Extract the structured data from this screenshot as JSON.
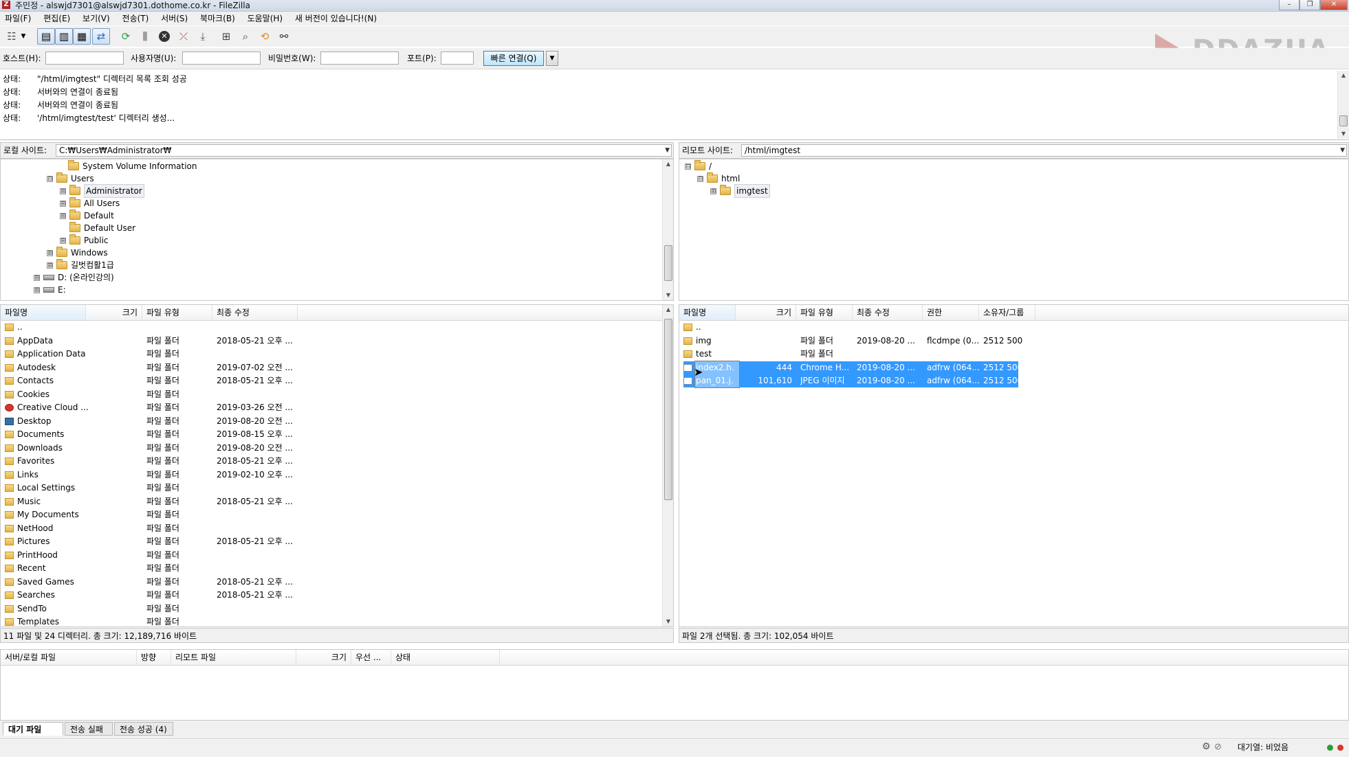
{
  "window": {
    "title": "주민정 - alswjd7301@alswjd7301.dothome.co.kr - FileZilla",
    "buttons": {
      "minimize": "–",
      "maximize": "❐",
      "close": "✕"
    }
  },
  "menu": [
    "파일(F)",
    "편집(E)",
    "보기(V)",
    "전송(T)",
    "서버(S)",
    "북마크(B)",
    "도움말(H)",
    "새 버전이 있습니다!(N)"
  ],
  "watermark": "DDAZUA",
  "quickconnect": {
    "host_label": "호스트(H):",
    "user_label": "사용자명(U):",
    "pass_label": "비밀번호(W):",
    "port_label": "포트(P):",
    "host_value": "",
    "user_value": "",
    "pass_value": "",
    "port_value": "",
    "connect_label": "빠른 연결(Q)",
    "dropdown_glyph": "▼"
  },
  "log": [
    {
      "key": "상태:",
      "msg": "\"/html/imgtest\" 디렉터리 목록 조회 성공"
    },
    {
      "key": "상태:",
      "msg": "서버와의 연결이 종료됨"
    },
    {
      "key": "상태:",
      "msg": "서버와의 연결이 종료됨"
    },
    {
      "key": "상태:",
      "msg": "'/html/imgtest/test' 디렉터리 생성..."
    }
  ],
  "local": {
    "site_label": "로컬 사이트:",
    "path": "C:₩Users₩Administrator₩",
    "tree": [
      {
        "label": "System Volume Information",
        "pm": ""
      },
      {
        "label": "Users",
        "pm": "⊟"
      },
      {
        "label": "Administrator",
        "pm": "⊞"
      },
      {
        "label": "All Users",
        "pm": "⊞"
      },
      {
        "label": "Default",
        "pm": "⊞"
      },
      {
        "label": "Default User",
        "pm": ""
      },
      {
        "label": "Public",
        "pm": "⊞"
      },
      {
        "label": "Windows",
        "pm": "⊞"
      },
      {
        "label": "길벗컴활1급",
        "pm": "⊞"
      },
      {
        "label": "D: (온라인강의)",
        "pm": "⊞"
      },
      {
        "label": "E:",
        "pm": "⊞"
      }
    ],
    "columns": [
      "파일명",
      "크기",
      "파일 유형",
      "최종 수정"
    ],
    "files": [
      {
        "name": "..",
        "size": "",
        "type": "",
        "modified": ""
      },
      {
        "name": "AppData",
        "size": "",
        "type": "파일 폴더",
        "modified": "2018-05-21 오후 ..."
      },
      {
        "name": "Application Data",
        "size": "",
        "type": "파일 폴더",
        "modified": ""
      },
      {
        "name": "Autodesk",
        "size": "",
        "type": "파일 폴더",
        "modified": "2019-07-02 오전 ..."
      },
      {
        "name": "Contacts",
        "size": "",
        "type": "파일 폴더",
        "modified": "2018-05-21 오후 ..."
      },
      {
        "name": "Cookies",
        "size": "",
        "type": "파일 폴더",
        "modified": ""
      },
      {
        "name": "Creative Cloud ...",
        "size": "",
        "type": "파일 폴더",
        "modified": "2019-03-26 오전 ..."
      },
      {
        "name": "Desktop",
        "size": "",
        "type": "파일 폴더",
        "modified": "2019-08-20 오전 ..."
      },
      {
        "name": "Documents",
        "size": "",
        "type": "파일 폴더",
        "modified": "2019-08-15 오후 ..."
      },
      {
        "name": "Downloads",
        "size": "",
        "type": "파일 폴더",
        "modified": "2019-08-20 오전 ..."
      },
      {
        "name": "Favorites",
        "size": "",
        "type": "파일 폴더",
        "modified": "2018-05-21 오후 ..."
      },
      {
        "name": "Links",
        "size": "",
        "type": "파일 폴더",
        "modified": "2019-02-10 오후 ..."
      },
      {
        "name": "Local Settings",
        "size": "",
        "type": "파일 폴더",
        "modified": ""
      },
      {
        "name": "Music",
        "size": "",
        "type": "파일 폴더",
        "modified": "2018-05-21 오후 ..."
      },
      {
        "name": "My Documents",
        "size": "",
        "type": "파일 폴더",
        "modified": ""
      },
      {
        "name": "NetHood",
        "size": "",
        "type": "파일 폴더",
        "modified": ""
      },
      {
        "name": "Pictures",
        "size": "",
        "type": "파일 폴더",
        "modified": "2018-05-21 오후 ..."
      },
      {
        "name": "PrintHood",
        "size": "",
        "type": "파일 폴더",
        "modified": ""
      },
      {
        "name": "Recent",
        "size": "",
        "type": "파일 폴더",
        "modified": ""
      },
      {
        "name": "Saved Games",
        "size": "",
        "type": "파일 폴더",
        "modified": "2018-05-21 오후 ..."
      },
      {
        "name": "Searches",
        "size": "",
        "type": "파일 폴더",
        "modified": "2018-05-21 오후 ..."
      },
      {
        "name": "SendTo",
        "size": "",
        "type": "파일 폴더",
        "modified": ""
      },
      {
        "name": "Templates",
        "size": "",
        "type": "파일 폴더",
        "modified": ""
      }
    ],
    "status": "11 파일 및 24 디렉터리. 총 크기: 12,189,716 바이트"
  },
  "remote": {
    "site_label": "리모트 사이트:",
    "path": "/html/imgtest",
    "tree": [
      {
        "label": "/",
        "pm": "⊟"
      },
      {
        "label": "html",
        "pm": "⊟"
      },
      {
        "label": "imgtest",
        "pm": "⊞"
      }
    ],
    "columns": [
      "파일명",
      "크기",
      "파일 유형",
      "최종 수정",
      "권한",
      "소유자/그룹"
    ],
    "files": [
      {
        "name": "..",
        "size": "",
        "type": "",
        "modified": "",
        "perm": "",
        "owner": ""
      },
      {
        "name": "img",
        "size": "",
        "type": "파일 폴더",
        "modified": "2019-08-20 ...",
        "perm": "flcdmpe (0...",
        "owner": "2512 500"
      },
      {
        "name": "test",
        "size": "",
        "type": "파일 폴더",
        "modified": "",
        "perm": "",
        "owner": ""
      },
      {
        "name": "index2.h...",
        "size": "444",
        "type": "Chrome H...",
        "modified": "2019-08-20 ...",
        "perm": "adfrw (064...",
        "owner": "2512 500"
      },
      {
        "name": "pan_01.j...",
        "size": "101,610",
        "type": "JPEG 이미지",
        "modified": "2019-08-20 ...",
        "perm": "adfrw (064...",
        "owner": "2512 500"
      }
    ],
    "status": "파일 2개 선택됨. 총 크기: 102,054 바이트"
  },
  "queue": {
    "columns": [
      "서버/로컬 파일",
      "방향",
      "리모트 파일",
      "크기",
      "우선 ...",
      "상태"
    ],
    "tabs": [
      "대기 파일",
      "전송 실패",
      "전송 성공 (4)"
    ]
  },
  "statusbar": {
    "queue": "대기열: 비었음"
  },
  "colors": {
    "selection": "#3399ff",
    "folder": "#e4b44a",
    "led_green": "#2e9e3e",
    "led_red": "#d23a2a"
  }
}
